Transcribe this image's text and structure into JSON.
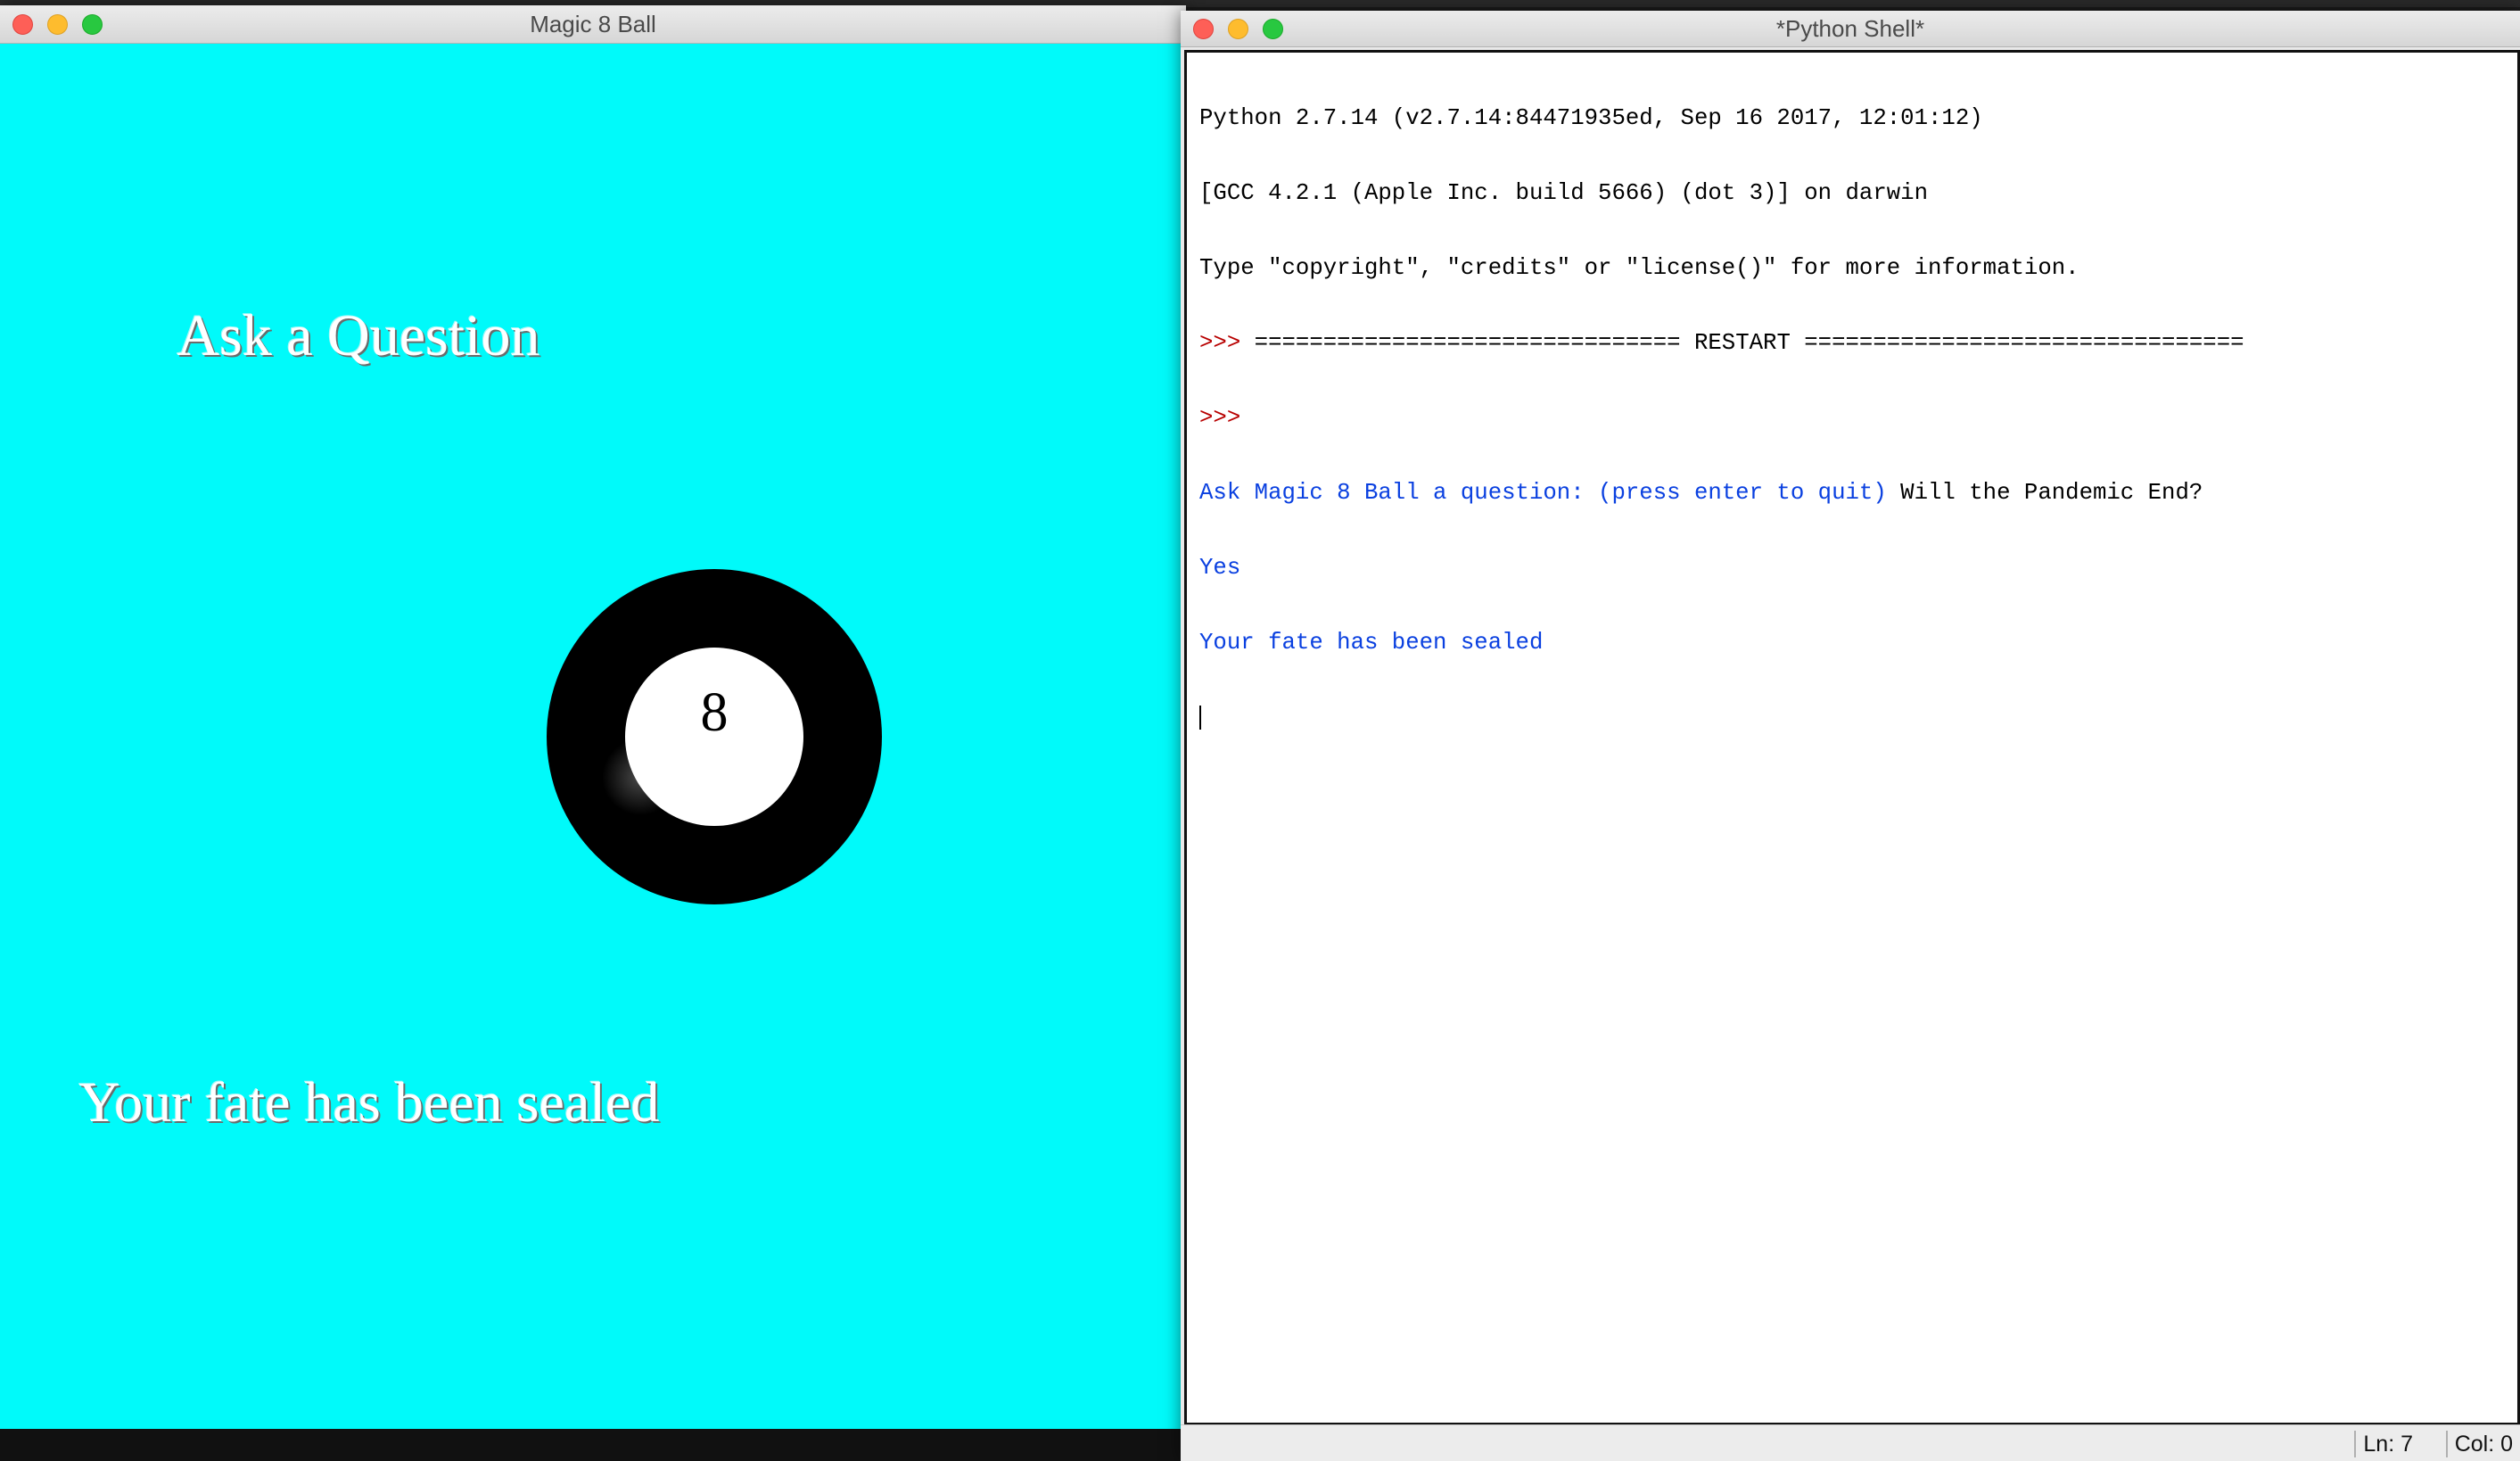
{
  "left_window": {
    "title": "Magic 8 Ball",
    "prompt_heading": "Ask a Question",
    "ball_number": "8",
    "answer_text": "Your fate has been sealed",
    "background_color": "#00fafa"
  },
  "right_window": {
    "title": "*Python Shell*",
    "lines": {
      "l1": "Python 2.7.14 (v2.7.14:84471935ed, Sep 16 2017, 12:01:12)",
      "l2": "[GCC 4.2.1 (Apple Inc. build 5666) (dot 3)] on darwin",
      "l3": "Type \"copyright\", \"credits\" or \"license()\" for more information.",
      "l4_prompt": ">>> ",
      "l4_text": "=============================== RESTART ================================",
      "l5_prompt": ">>> ",
      "l6_prompt_text": "Ask Magic 8 Ball a question: (press enter to quit) ",
      "l6_input": "Will the Pandemic End?",
      "l7": "Yes",
      "l8": "Your fate has been sealed"
    },
    "status": {
      "line": "Ln: 7",
      "col": "Col: 0"
    }
  },
  "colors": {
    "prompt_red": "#b80000",
    "output_blue": "#0a40e0"
  }
}
